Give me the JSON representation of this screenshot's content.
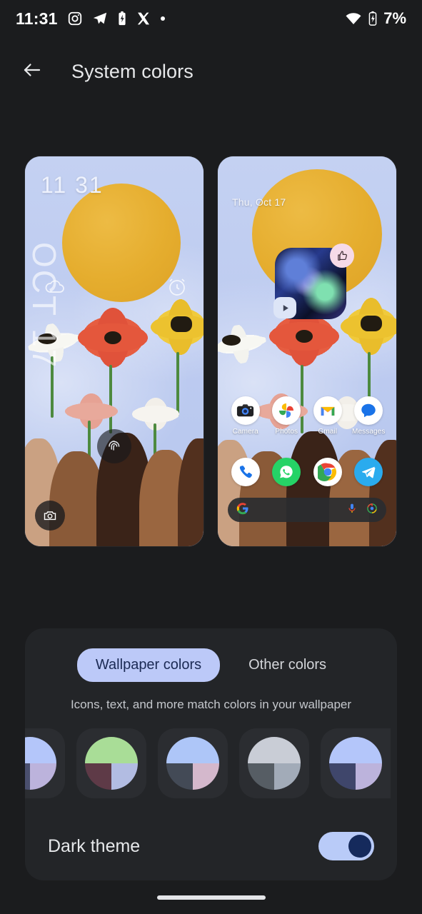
{
  "status_bar": {
    "time": "11:31",
    "battery_percent": "7%",
    "left_icons": [
      "instagram-icon",
      "telegram-icon",
      "battery-charging-icon",
      "x-twitter-icon",
      "dot-icon"
    ],
    "right_icons": [
      "wifi-icon",
      "battery-icon"
    ]
  },
  "app_bar": {
    "back_icon": "back-arrow-icon",
    "title": "System colors"
  },
  "previews": {
    "lock_screen": {
      "name": "lock-screen-preview",
      "time": "11 31",
      "date_vertical": "OCT 17",
      "icons": [
        "cloud-weather-icon",
        "alarm-clock-icon",
        "fingerprint-icon",
        "camera-shortcut-icon"
      ]
    },
    "home_screen": {
      "name": "home-screen-preview",
      "date": "Thu, Oct 17",
      "media_widget": {
        "thumb_up_icon": "thumbs-up-icon",
        "play_icon": "play-icon"
      },
      "apps": [
        {
          "label": "Camera",
          "icon": "camera-app-icon"
        },
        {
          "label": "Photos",
          "icon": "photos-app-icon"
        },
        {
          "label": "Gmail",
          "icon": "gmail-app-icon"
        },
        {
          "label": "Messages",
          "icon": "messages-app-icon"
        }
      ],
      "dock": [
        {
          "label": "Phone",
          "icon": "phone-app-icon"
        },
        {
          "label": "WhatsApp",
          "icon": "whatsapp-app-icon"
        },
        {
          "label": "Chrome",
          "icon": "chrome-app-icon"
        },
        {
          "label": "Telegram",
          "icon": "telegram-app-icon"
        }
      ],
      "search_bar": {
        "google_icon": "google-g-icon",
        "mic_icon": "microphone-icon",
        "lens_icon": "google-lens-icon"
      }
    }
  },
  "options_card": {
    "tabs": [
      {
        "label": "Wallpaper colors",
        "selected": true
      },
      {
        "label": "Other colors",
        "selected": false
      }
    ],
    "description": "Icons, text, and more match colors in your wallpaper",
    "swatches": [
      {
        "name": "swatch-1",
        "selected": true,
        "top": "#B4C6FA",
        "bottom_left": "#4A4F6E",
        "bottom_right": "#BCB3DC"
      },
      {
        "name": "swatch-2",
        "selected": false,
        "top": "#A9DD97",
        "bottom_left": "#5E3A47",
        "bottom_right": "#B2BCE2"
      },
      {
        "name": "swatch-3",
        "selected": false,
        "top": "#AEC6F8",
        "bottom_left": "#434A56",
        "bottom_right": "#D4B8CC"
      },
      {
        "name": "swatch-4",
        "selected": false,
        "top": "#C9CDD6",
        "bottom_left": "#565D64",
        "bottom_right": "#A2ABB8"
      },
      {
        "name": "swatch-5",
        "selected": false,
        "top": "#B4C6FA",
        "bottom_left": "#3F466B",
        "bottom_right": "#BCB3DC"
      }
    ],
    "dark_theme": {
      "label": "Dark theme",
      "enabled": true,
      "track_color": "#B9CBF8",
      "knob_color": "#152A5C"
    }
  },
  "nav_bar": {
    "gesture_pill": "home-gesture-pill"
  },
  "theme": {
    "background": "#1B1C1E",
    "card_background": "#232528",
    "accent": "#BCC9F8",
    "text_primary": "#E6E8EA",
    "text_secondary": "#C4C7CC"
  }
}
